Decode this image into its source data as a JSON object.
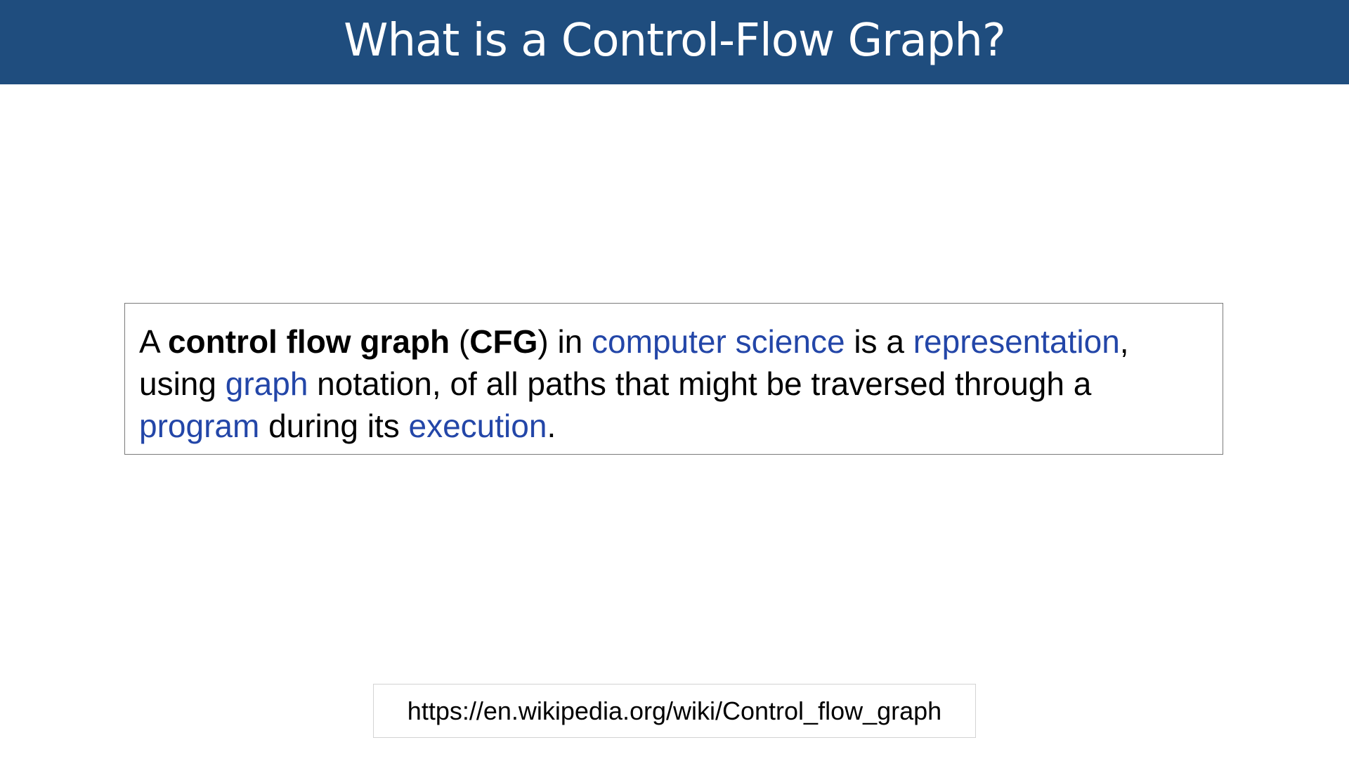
{
  "slide": {
    "title": "What is a Control-Flow Graph?"
  },
  "definition": {
    "w1": "A ",
    "term": "control flow graph",
    "w2": " (",
    "abbr": "CFG",
    "w3": ") in ",
    "link1": "computer science",
    "w4": " is a ",
    "link2": "representation",
    "w5": ", using ",
    "link3": "graph",
    "w6": " notation, of all paths that might be traversed through a ",
    "link4": "program",
    "w7": " during its ",
    "link5": "execution",
    "w8": "."
  },
  "source": {
    "url": "https://en.wikipedia.org/wiki/Control_flow_graph"
  },
  "colors": {
    "title_bar": "#1f4d7e",
    "link": "#2346a8"
  }
}
